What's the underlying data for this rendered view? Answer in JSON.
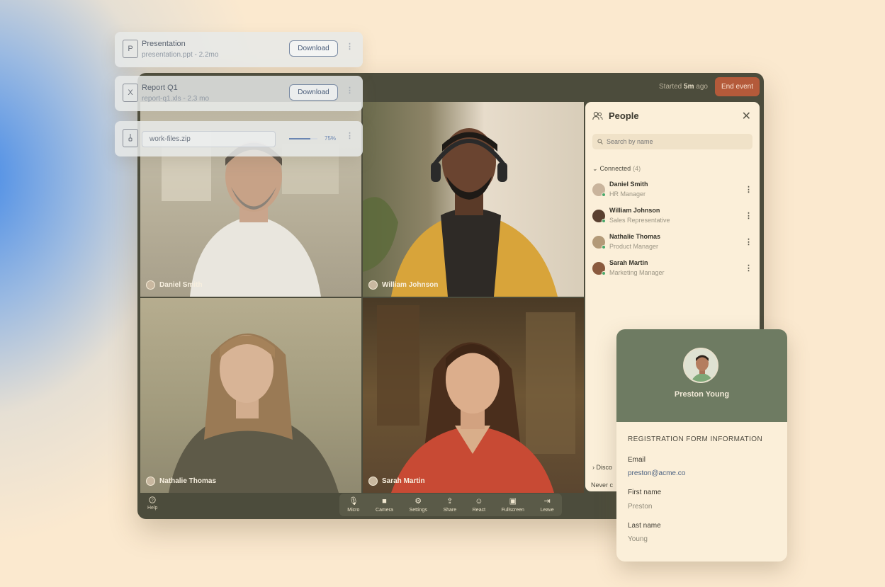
{
  "window": {
    "started_prefix": "Started",
    "started_value": "5m",
    "started_suffix": "ago",
    "end_event_label": "End event"
  },
  "tiles": [
    {
      "name": "Daniel Smith"
    },
    {
      "name": "William Johnson"
    },
    {
      "name": "Nathalie Thomas"
    },
    {
      "name": "Sarah Martin"
    }
  ],
  "people_panel": {
    "title": "People",
    "search_placeholder": "Search by name",
    "connected_label": "Connected",
    "connected_count": "(4)",
    "members": [
      {
        "name": "Daniel Smith",
        "role": "HR Manager",
        "status_color": "#4aa86b"
      },
      {
        "name": "William Johnson",
        "role": "Sales Representative",
        "status_color": "#4aa86b"
      },
      {
        "name": "Nathalie Thomas",
        "role": "Product Manager",
        "status_color": "#4aa86b"
      },
      {
        "name": "Sarah Martin",
        "role": "Marketing Manager",
        "status_color": "#4aa86b"
      }
    ],
    "disconnected_label": "Disco",
    "never_label": "Never c"
  },
  "toolbar": {
    "help_label": "Help",
    "controls": [
      {
        "label": "Micro",
        "icon": "microphone-icon"
      },
      {
        "label": "Camera",
        "icon": "camera-icon"
      },
      {
        "label": "Settings",
        "icon": "gear-icon"
      },
      {
        "label": "Share",
        "icon": "share-icon"
      },
      {
        "label": "React",
        "icon": "smile-icon"
      },
      {
        "label": "Fullscreen",
        "icon": "fullscreen-icon"
      },
      {
        "label": "Leave",
        "icon": "leave-icon"
      }
    ]
  },
  "files": [
    {
      "icon_letter": "P",
      "title": "Presentation",
      "subtitle": "presentation.ppt - 2.2mo",
      "action": "Download"
    },
    {
      "icon_letter": "X",
      "title": "Report Q1",
      "subtitle": "report-q1.xls - 2.3 mo",
      "action": "Download"
    },
    {
      "filename": "work-files.zip",
      "progress": 0.75,
      "progress_label": "75%"
    }
  ],
  "profile": {
    "name": "Preston Young",
    "section_title": "REGISTRATION FORM INFORMATION",
    "email_label": "Email",
    "email_value": "preston@acme.co",
    "first_name_label": "First name",
    "first_name_value": "Preston",
    "last_name_label": "Last name",
    "last_name_value": "Young"
  },
  "colors": {
    "background": "#fbe9cf",
    "window": "#4c4c3c",
    "end_event": "#b45a3a",
    "profile_header": "#6e7b62",
    "online": "#4aa86b",
    "accent_blue": "#3a84e8"
  }
}
